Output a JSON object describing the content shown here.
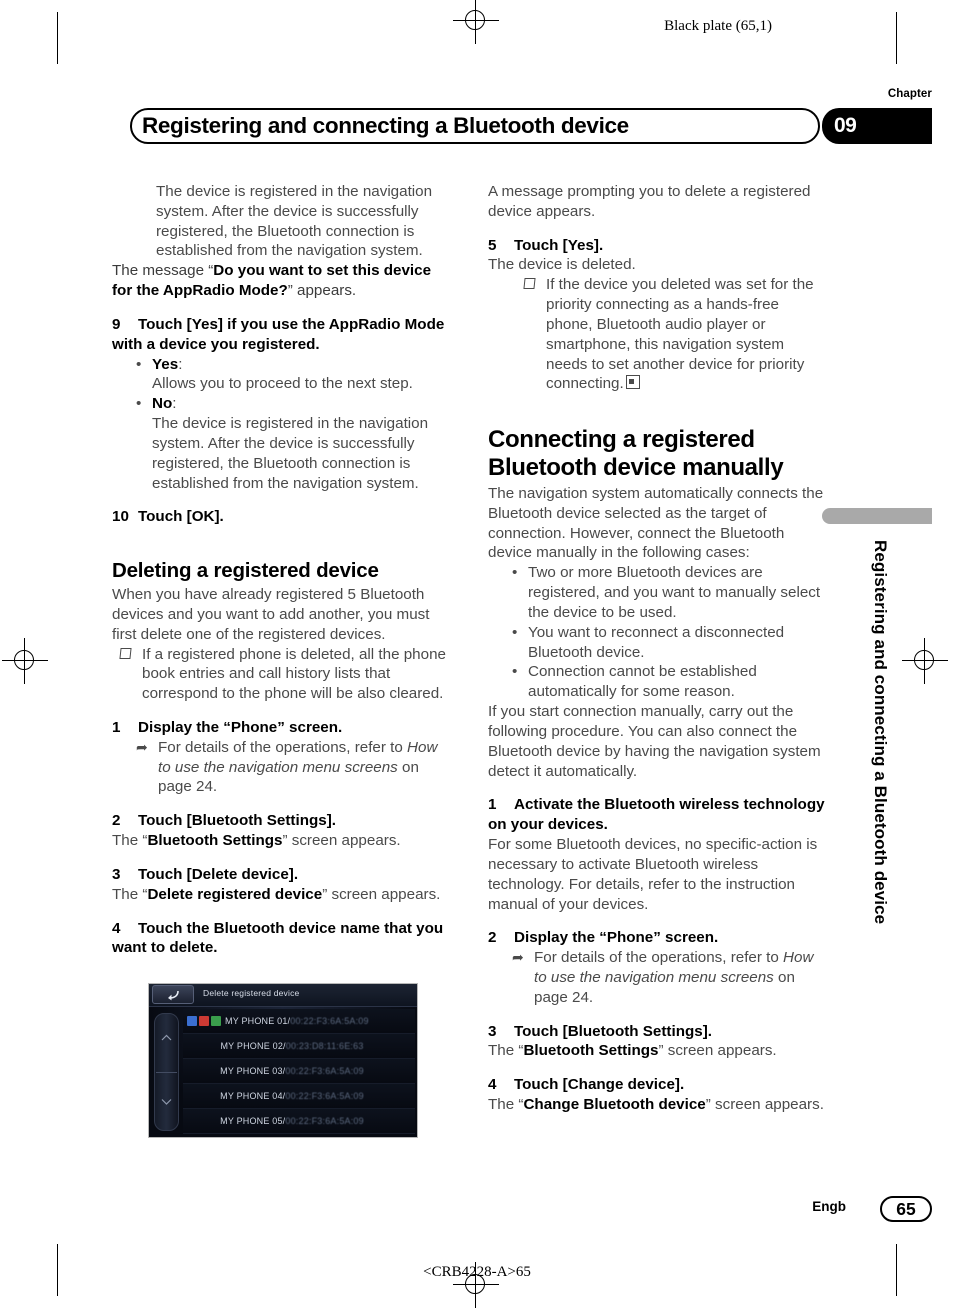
{
  "page": {
    "plate_label": "Black plate (65,1)",
    "chapter_word": "Chapter",
    "chapter_number": "09",
    "header_title": "Registering and connecting a Bluetooth device",
    "side_tab_text": "Registering and connecting a Bluetooth device",
    "footer_language": "Engb",
    "footer_page_number": "65",
    "footer_code": "<CRB4228-A>65"
  },
  "left_column": {
    "intro_indent": "The device is registered in the navigation system. After the device is successfully registered, the Bluetooth connection is established from the navigation system.",
    "message_prefix": "The message “",
    "message_bold": "Do you want to set this device for the AppRadio Mode?",
    "message_suffix": "” appears.",
    "step9_num": "9",
    "step9_text": "Touch [Yes] if you use the AppRadio Mode with a device you registered.",
    "bullet_yes_label": "Yes",
    "bullet_yes_colon": ":",
    "bullet_yes_body": "Allows you to proceed to the next step.",
    "bullet_no_label": "No",
    "bullet_no_colon": ":",
    "bullet_no_body": "The device is registered in the navigation system. After the device is successfully registered, the Bluetooth connection is established from the navigation system.",
    "step10_num": "10",
    "step10_text": "Touch [OK].",
    "section_title": "Deleting a registered device",
    "section_body": "When you have already registered 5 Bluetooth devices and you want to add another, you must first delete one of the registered devices.",
    "note1": "If a registered phone is deleted, all the phone book entries and call history lists that correspond to the phone will be also cleared.",
    "step1_num": "1",
    "step1_text": "Display the “Phone” screen.",
    "ref1_prefix": "For details of the operations, refer to ",
    "ref1_italic": "How to use the navigation menu screens",
    "ref1_suffix": " on page 24.",
    "step2_num": "2",
    "step2_text": "Touch [Bluetooth Settings].",
    "after2_prefix": "The “",
    "after2_bold": "Bluetooth Settings",
    "after2_suffix": "” screen appears.",
    "step3_num": "3",
    "step3_text": "Touch [Delete device].",
    "after3_prefix": "The “",
    "after3_bold": "Delete registered device",
    "after3_suffix": "” screen appears.",
    "step4_num": "4",
    "step4_text": "Touch the Bluetooth device name that you want to delete."
  },
  "device_screen": {
    "back_icon": "back-arrow-icon",
    "title": "Delete registered device",
    "scroll_up_icon": "chevron-up-icon",
    "scroll_down_icon": "chevron-down-icon",
    "items": [
      {
        "name": "MY PHONE 01/",
        "mac": "00:22:F3:6A:5A:09",
        "icons": [
          "blue",
          "red",
          "green"
        ]
      },
      {
        "name": "MY PHONE 02/",
        "mac": "00:23:D8:11:6E:63",
        "icons": []
      },
      {
        "name": "MY PHONE 03/",
        "mac": "00:22:F3:6A:5A:09",
        "icons": []
      },
      {
        "name": "MY PHONE 04/",
        "mac": "00:22:F3:6A:5A:09",
        "icons": []
      },
      {
        "name": "MY PHONE 05/",
        "mac": "00:22:F3:6A:5A:09",
        "icons": []
      }
    ]
  },
  "right_column": {
    "intro": "A message prompting you to delete a registered device appears.",
    "step5_num": "5",
    "step5_text": "Touch [Yes].",
    "after5": "The device is deleted.",
    "note1": "If the device you deleted was set for the priority connecting as a hands-free phone, Bluetooth audio player or smartphone, this navigation system needs to set another device for priority connecting.",
    "section_title": "Connecting a registered Bluetooth device manually",
    "section_body": "The navigation system automatically connects the Bluetooth device selected as the target of connection. However, connect the Bluetooth device manually in the following cases:",
    "bullets": [
      "Two or more Bluetooth devices are registered, and you want to manually select the device to be used.",
      "You want to reconnect a disconnected Bluetooth device.",
      "Connection cannot be established automatically for some reason."
    ],
    "after_bullets": "If you start connection manually, carry out the following procedure. You can also connect the Bluetooth device by having the navigation system detect it automatically.",
    "step1_num": "1",
    "step1_text": "Activate the Bluetooth wireless technology on your devices.",
    "after1": "For some Bluetooth devices, no specific-action is necessary to activate Bluetooth wireless technology. For details, refer to the instruction manual of your devices.",
    "step2_num": "2",
    "step2_text": "Display the “Phone” screen.",
    "ref2_prefix": "For details of the operations, refer to ",
    "ref2_italic": "How to use the navigation menu screens",
    "ref2_suffix": " on page 24.",
    "step3_num": "3",
    "step3_text": "Touch [Bluetooth Settings].",
    "after3_prefix": "The “",
    "after3_bold": "Bluetooth Settings",
    "after3_suffix": "” screen appears.",
    "step4_num": "4",
    "step4_text": "Touch [Change device].",
    "after4_prefix": "The “",
    "after4_bold": "Change Bluetooth device",
    "after4_suffix": "” screen appears."
  }
}
